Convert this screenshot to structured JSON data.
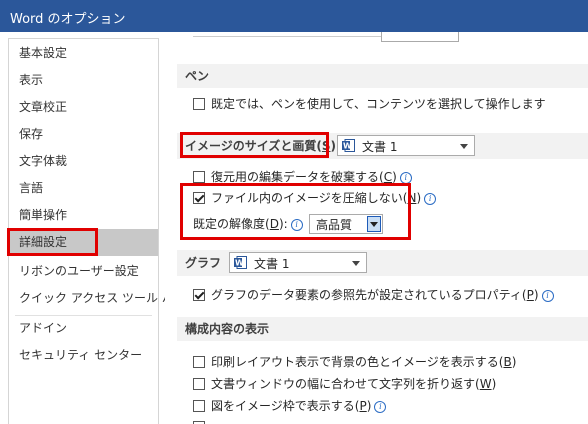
{
  "window": {
    "title": "Word のオプション"
  },
  "sidebar": {
    "items": [
      {
        "label": "基本設定"
      },
      {
        "label": "表示"
      },
      {
        "label": "文章校正"
      },
      {
        "label": "保存"
      },
      {
        "label": "文字体裁"
      },
      {
        "label": "言語"
      },
      {
        "label": "簡単操作"
      },
      {
        "label": "詳細設定",
        "selected": true
      },
      {
        "label": "リボンのユーザー設定"
      },
      {
        "label": "クイック アクセス ツール バー"
      },
      {
        "label": "アドイン"
      },
      {
        "label": "セキュリティ センター"
      }
    ]
  },
  "pen": {
    "header": "ペン",
    "option": "既定では、ペンを使用して、コンテンツを選択して操作します"
  },
  "image": {
    "header_pre": "イメージのサイズと画質(",
    "header_key": "S",
    "header_post": ")",
    "doc_select": "文書 1",
    "discard_pre": "復元用の編集データを破棄する(",
    "discard_key": "C",
    "discard_post": ")",
    "compress_pre": "ファイル内のイメージを圧縮しない(",
    "compress_key": "N",
    "compress_post": ")",
    "compress_checked": true,
    "resolution_pre": "既定の解像度(",
    "resolution_key": "D",
    "resolution_post": "):",
    "resolution_value": "高品質"
  },
  "graph": {
    "header": "グラフ",
    "doc_select": "文書 1",
    "option_pre": "グラフのデータ要素の参照先が設定されているプロパティ(",
    "option_key": "P",
    "option_post": ")",
    "option_checked": true
  },
  "content": {
    "header": "構成内容の表示",
    "opt1_pre": "印刷レイアウト表示で背景の色とイメージを表示する(",
    "opt1_key": "B",
    "opt1_post": ")",
    "opt2_pre": "文書ウィンドウの幅に合わせて文字列を折り返す(",
    "opt2_key": "W",
    "opt2_post": ")",
    "opt3_pre": "図をイメージ枠で表示する(",
    "opt3_key": "P",
    "opt3_post": ")"
  },
  "colors": {
    "titlebar": "#2b579a",
    "highlight": "#e00000",
    "selected_nav": "#c8c8c8"
  }
}
